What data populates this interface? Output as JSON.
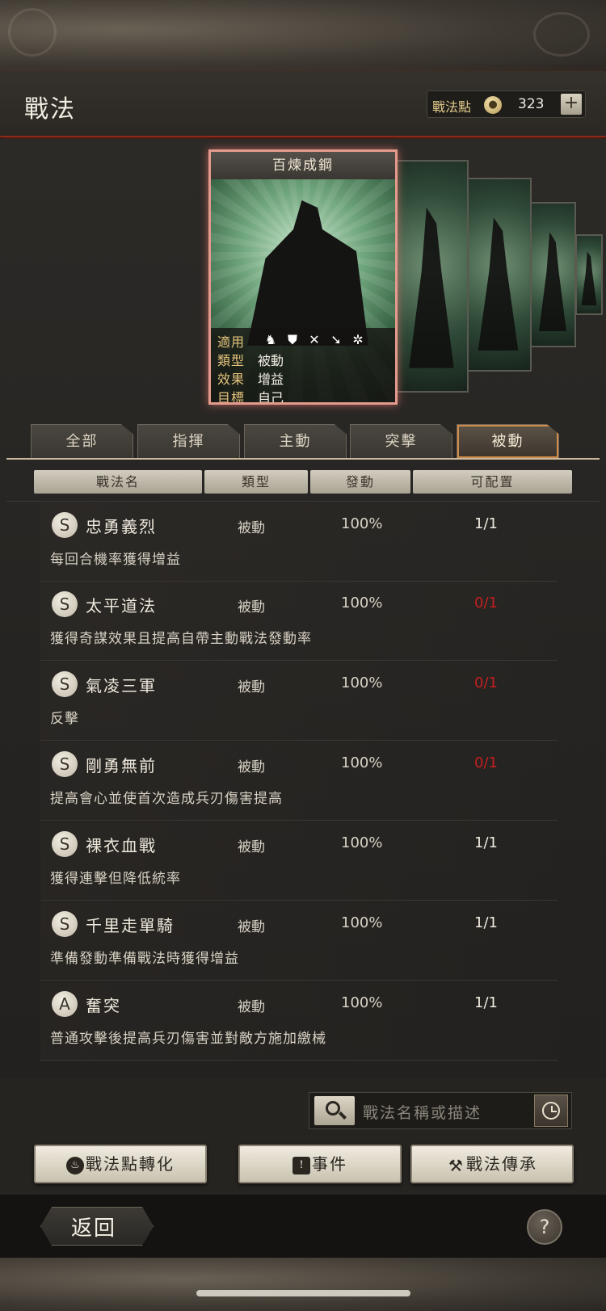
{
  "header": {
    "title": "戰法",
    "points_label": "戰法點",
    "points_value": "323",
    "add_label": "+"
  },
  "featured_card": {
    "name": "百煉成鋼",
    "rows": [
      {
        "key": "適用",
        "icons": [
          "cavalry-icon",
          "shield-icon",
          "bow-icon",
          "spear-icon",
          "wheel-icon"
        ]
      },
      {
        "key": "類型",
        "value": "被動"
      },
      {
        "key": "效果",
        "value": "增益"
      },
      {
        "key": "目標",
        "value": "自己"
      }
    ],
    "icon_glyphs": [
      "♞",
      "⛊",
      "✕",
      "➘",
      "✲"
    ]
  },
  "tabs": [
    {
      "label": "全部"
    },
    {
      "label": "指揮"
    },
    {
      "label": "主動"
    },
    {
      "label": "突擊"
    },
    {
      "label": "被動",
      "active": true
    }
  ],
  "columns": [
    "戰法名",
    "類型",
    "發動",
    "可配置"
  ],
  "skills": [
    {
      "grade": "S",
      "name": "忠勇義烈",
      "type": "被動",
      "rate": "100%",
      "count": "1/1",
      "count_red": false,
      "desc": "每回合機率獲得增益"
    },
    {
      "grade": "S",
      "name": "太平道法",
      "type": "被動",
      "rate": "100%",
      "count": "0/1",
      "count_red": true,
      "desc": "獲得奇謀效果且提高自帶主動戰法發動率"
    },
    {
      "grade": "S",
      "name": "氣凌三軍",
      "type": "被動",
      "rate": "100%",
      "count": "0/1",
      "count_red": true,
      "desc": "反擊"
    },
    {
      "grade": "S",
      "name": "剛勇無前",
      "type": "被動",
      "rate": "100%",
      "count": "0/1",
      "count_red": true,
      "desc": "提高會心並使首次造成兵刃傷害提高"
    },
    {
      "grade": "S",
      "name": "裸衣血戰",
      "type": "被動",
      "rate": "100%",
      "count": "1/1",
      "count_red": false,
      "desc": "獲得連擊但降低統率"
    },
    {
      "grade": "S",
      "name": "千里走單騎",
      "type": "被動",
      "rate": "100%",
      "count": "1/1",
      "count_red": false,
      "desc": "準備發動準備戰法時獲得增益"
    },
    {
      "grade": "A",
      "name": "奮突",
      "type": "被動",
      "rate": "100%",
      "count": "1/1",
      "count_red": false,
      "desc": "普通攻擊後提高兵刃傷害並對敵方施加繳械"
    }
  ],
  "search": {
    "placeholder": "戰法名稱或描述"
  },
  "actions": {
    "convert_label": "戰法點轉化",
    "event_label": "事件",
    "inherit_label": "戰法傳承"
  },
  "footer": {
    "back_label": "返回",
    "help_label": "?"
  },
  "colors": {
    "accent_red": "#c51f1f",
    "tab_active_border": "#d18c4a",
    "card_border": "#e49a8c"
  }
}
